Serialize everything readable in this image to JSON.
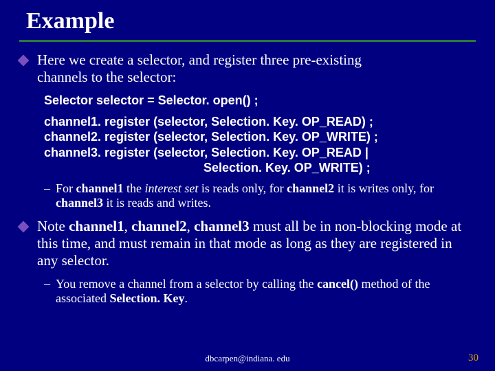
{
  "title": "Example",
  "bullet1": {
    "text_a": "Here we create a selector, and register three pre-existing",
    "text_b": "channels to the selector:"
  },
  "code1": "Selector selector = Selector. open() ;",
  "code2": {
    "l1": "channel1. register (selector, Selection. Key. OP_READ) ;",
    "l2": "channel2. register (selector, Selection. Key. OP_WRITE) ;",
    "l3": "channel3. register (selector, Selection. Key. OP_READ |",
    "l4": "Selection. Key. OP_WRITE) ;"
  },
  "sub1": {
    "pre": "For ",
    "c1": "channel1",
    "mid1": " the ",
    "iset": "interest set",
    "mid2": " is reads only, for ",
    "c2": "channel2",
    "mid3": " it is writes only, for ",
    "c3": "channel3",
    "mid4": " it is reads and writes."
  },
  "bullet2": {
    "pre": "Note ",
    "c1": "channel1",
    "com1": ", ",
    "c2": "channel2",
    "com2": ", ",
    "c3": "channel3",
    "rest": " must all be in non-blocking mode at this time, and must remain in that mode as long as they are registered in any selector."
  },
  "sub2": {
    "pre": "You remove a channel from a selector by calling the ",
    "cancel": "cancel()",
    "mid": " method of the associated ",
    "sk": "Selection. Key",
    "end": "."
  },
  "footer": "dbcarpen@indiana. edu",
  "page": "30"
}
